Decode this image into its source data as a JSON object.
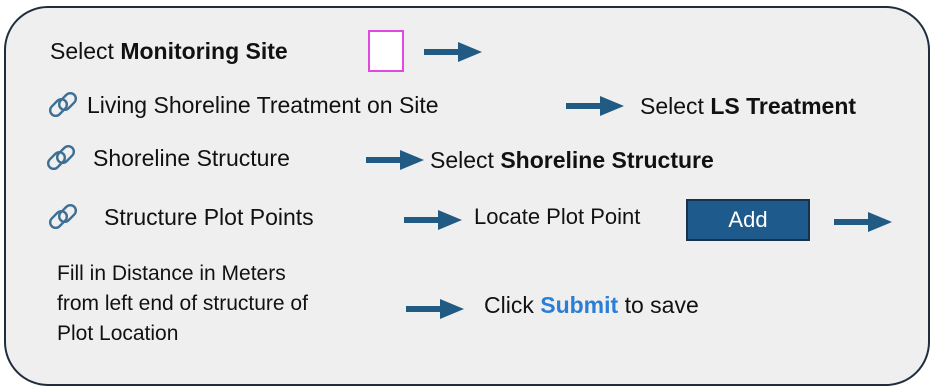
{
  "colors": {
    "panel_bg": "#efefef",
    "panel_border": "#1f2d3d",
    "arrow": "#215a82",
    "site_box_border": "#e048e0",
    "add_button_bg": "#1f5a8c",
    "submit_text": "#2a7ed6"
  },
  "icons": {
    "link": "link-icon",
    "arrow": "arrow-right-icon"
  },
  "step1": {
    "prefix": "Select ",
    "bold": "Monitoring Site"
  },
  "step2": {
    "label": "Living Shoreline Treatment on Site",
    "action_prefix": "Select ",
    "action_bold": "LS Treatment"
  },
  "step3": {
    "label": "Shoreline Structure",
    "action_prefix": "Select ",
    "action_bold": "Shoreline Structure"
  },
  "step4": {
    "label": "Structure Plot Points",
    "action": "Locate Plot Point",
    "button": "Add"
  },
  "step5": {
    "lines": [
      "Fill in Distance in Meters",
      "from left end of structure of",
      "Plot Location"
    ],
    "action_prefix": "Click ",
    "action_bold": "Submit",
    "action_suffix": " to save"
  }
}
